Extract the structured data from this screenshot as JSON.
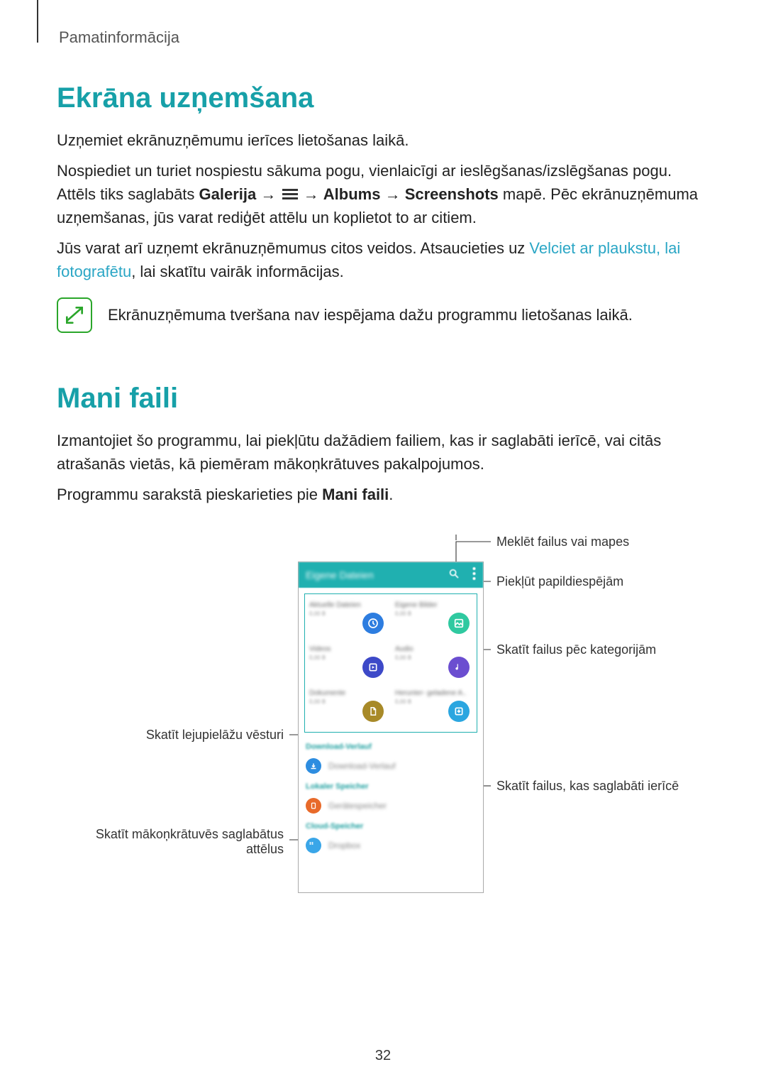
{
  "breadcrumb": "Pamatinformācija",
  "sec1": {
    "title": "Ekrāna uzņemšana",
    "p1": "Uzņemiet ekrānuzņēmumu ierīces lietošanas laikā.",
    "p2a": "Nospiediet un turiet nospiestu sākuma pogu, vienlaicīgi ar ieslēgšanas/izslēgšanas pogu. Attēls tiks saglabāts ",
    "p2_gal": "Galerija",
    "p2_arrow": "→",
    "p2_albums": "Albums",
    "p2_screens": "Screenshots",
    "p2b": " mapē. Pēc ekrānuzņēmuma uzņemšanas, jūs varat rediģēt attēlu un koplietot to ar citiem.",
    "p3a": "Jūs varat arī uzņemt ekrānuzņēmumus citos veidos. Atsaucieties uz ",
    "p3_link": "Velciet ar plaukstu, lai fotografētu",
    "p3b": ", lai skatītu vairāk informācijas.",
    "note": "Ekrānuzņēmuma tveršana nav iespējama dažu programmu lietošanas laikā."
  },
  "sec2": {
    "title": "Mani faili",
    "p1": "Izmantojiet šo programmu, lai piekļūtu dažādiem failiem, kas ir saglabāti ierīcē, vai citās atrašanās vietās, kā piemēram mākoņkrātuves pakalpojumos.",
    "p2a": "Programmu sarakstā pieskarieties pie ",
    "p2b": "Mani faili",
    "p2c": "."
  },
  "callouts": {
    "search": "Meklēt failus vai mapes",
    "more": "Piekļūt papildiespējām",
    "byCat": "Skatīt failus pēc kategorijām",
    "downloads": "Skatīt lejupielāžu vēsturi",
    "device": "Skatīt failus, kas saglabāti ierīcē",
    "cloud1": "Skatīt mākoņkrātuvēs saglabātus",
    "cloud2": "attēlus"
  },
  "phone": {
    "title": "Eigene Dateien",
    "cells": {
      "c1": "Aktuelle Dateien",
      "c2": "Eigene Bilder",
      "c3": "Videos",
      "c4": "Audio",
      "c5": "Dokumente",
      "c6": "Herunter- geladene A..",
      "sub": "0,00 B"
    },
    "h1": "Download-Verlauf",
    "i1": "Download-Verlauf",
    "h2": "Lokaler Speicher",
    "i2": "Gerätespeicher",
    "h3": "Cloud-Speicher",
    "i3": "Dropbox"
  },
  "pagenum": "32"
}
